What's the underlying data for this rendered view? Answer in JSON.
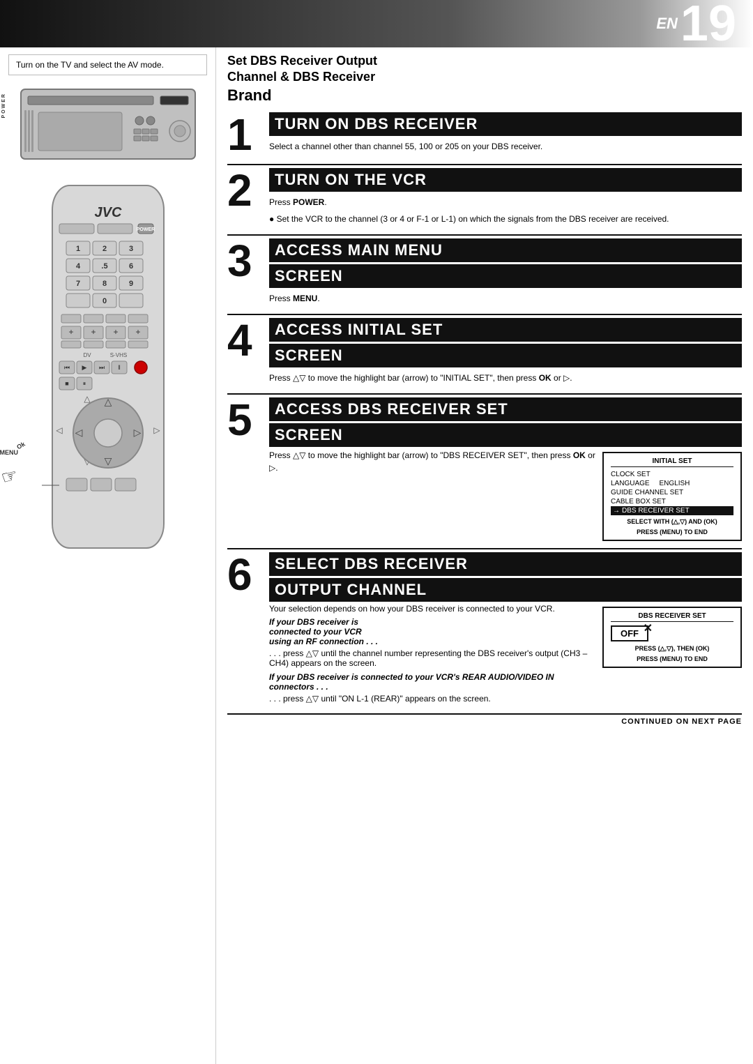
{
  "header": {
    "en_label": "EN",
    "page_number": "19"
  },
  "left_col": {
    "intro_text": "Turn on the TV and select the AV mode.",
    "power_label": "POWER"
  },
  "right_col": {
    "page_title": {
      "line1": "Set DBS Receiver Output",
      "line2": "Channel & DBS Receiver",
      "line3": "Brand"
    },
    "step1": {
      "number": "1",
      "heading": "TURN ON DBS RECEIVER",
      "body": "Select a channel other than channel 55, 100 or 205 on your DBS receiver."
    },
    "step2": {
      "number": "2",
      "heading": "TURN ON THE VCR",
      "body1": "Press POWER.",
      "power_bold": "POWER",
      "body2": "Set the VCR to the channel (3 or 4 or F-1 or L-1) on which the signals from the DBS receiver are received."
    },
    "step3": {
      "number": "3",
      "heading": "ACCESS MAIN MENU",
      "heading2": "SCREEN",
      "body": "Press MENU.",
      "menu_bold": "MENU"
    },
    "step4": {
      "number": "4",
      "heading": "ACCESS INITIAL SET",
      "heading2": "SCREEN",
      "body": "Press △▽ to move the highlight bar (arrow) to \"INITIAL SET\", then press OK or ▷.",
      "ok_bold": "OK"
    },
    "step5": {
      "number": "5",
      "heading": "ACCESS DBS RECEIVER SET",
      "heading2": "SCREEN",
      "body": "Press △▽ to move the highlight bar (arrow) to \"DBS RECEIVER SET\", then press OK or ▷.",
      "ok_bold": "OK",
      "screen": {
        "title": "INITIAL SET",
        "items": [
          "CLOCK SET",
          "LANGUAGE          ENGLISH",
          "GUIDE CHANNEL SET",
          "CABLE BOX SET",
          "→DBS RECEIVER SET"
        ],
        "note1": "SELECT WITH (△,▽) AND (OK)",
        "note2": "PRESS (MENU) TO END"
      }
    },
    "step6": {
      "number": "6",
      "heading": "SELECT DBS RECEIVER",
      "heading2": "OUTPUT CHANNEL",
      "body1": "Your selection depends on how your DBS receiver is connected to your VCR.",
      "section1_heading": "If your DBS receiver is connected to your VCR using an RF connection . . .",
      "section1_body": ". . . press △▽ until the channel number representing the DBS receiver's output (CH3 – CH4) appears on the screen.",
      "section2_heading": "If your DBS receiver is connected to your VCR's REAR AUDIO/VIDEO IN connectors . . .",
      "section2_body": ". . . press △▽ until \"ON L-1 (REAR)\" appears on the screen.",
      "screen": {
        "title": "DBS RECEIVER SET",
        "off_label": "OFF",
        "note1": "PRESS (△,▽), THEN (OK)",
        "note2": "PRESS (MENU) TO END"
      }
    },
    "continued": "CONTINUED ON NEXT PAGE"
  },
  "remote": {
    "brand": "JVC",
    "power_label": "POWER",
    "menu_label": "MENU",
    "ok_label": "Ok",
    "buttons": {
      "nums": [
        "1",
        "2",
        "3",
        "4",
        ".5",
        "6",
        "7",
        "8",
        "9",
        "",
        "0",
        ""
      ]
    }
  }
}
